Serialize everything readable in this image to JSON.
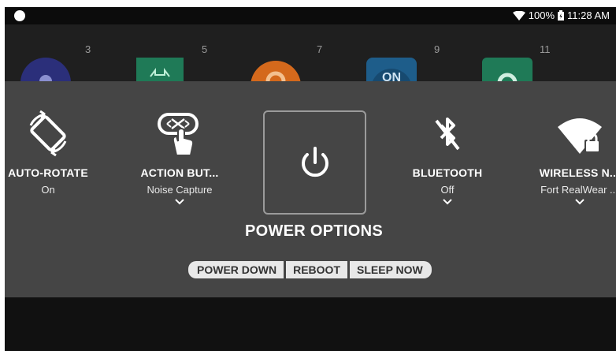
{
  "status_bar": {
    "battery": "100%",
    "time": "11:28 AM",
    "icons": [
      "notification-dot-icon",
      "wifi-icon",
      "battery-icon"
    ]
  },
  "background_apps": [
    {
      "number": "3",
      "icon": "app-circle-icon",
      "color": "#2b2f7a"
    },
    {
      "number": "5",
      "icon": "app-green-icon",
      "color": "#1f7a57"
    },
    {
      "number": "7",
      "icon": "gear-icon",
      "color": "#d4691c"
    },
    {
      "number": "9",
      "icon": "on-badge-icon",
      "color": "#1e5d8a"
    },
    {
      "number": "11",
      "icon": "settings-gear-icon",
      "color": "#1f7a57"
    }
  ],
  "tiles": [
    {
      "title": "AUTO-ROTATE",
      "subtitle": "On",
      "icon": "rotate-icon"
    },
    {
      "title": "ACTION BUT...",
      "subtitle": "Noise Capture",
      "icon": "action-button-icon"
    },
    {
      "title": "BLUETOOTH",
      "subtitle": "Off",
      "icon": "bluetooth-off-icon"
    },
    {
      "title": "WIRELESS N...",
      "subtitle": "Fort RealWear ...",
      "icon": "wifi-lock-icon"
    }
  ],
  "power": {
    "title": "POWER OPTIONS",
    "buttons": [
      "POWER DOWN",
      "REBOOT",
      "SLEEP NOW"
    ]
  },
  "colors": {
    "panel": "#454545",
    "background": "#111111",
    "button_bg": "#e8e8e8",
    "button_text": "#333333"
  }
}
